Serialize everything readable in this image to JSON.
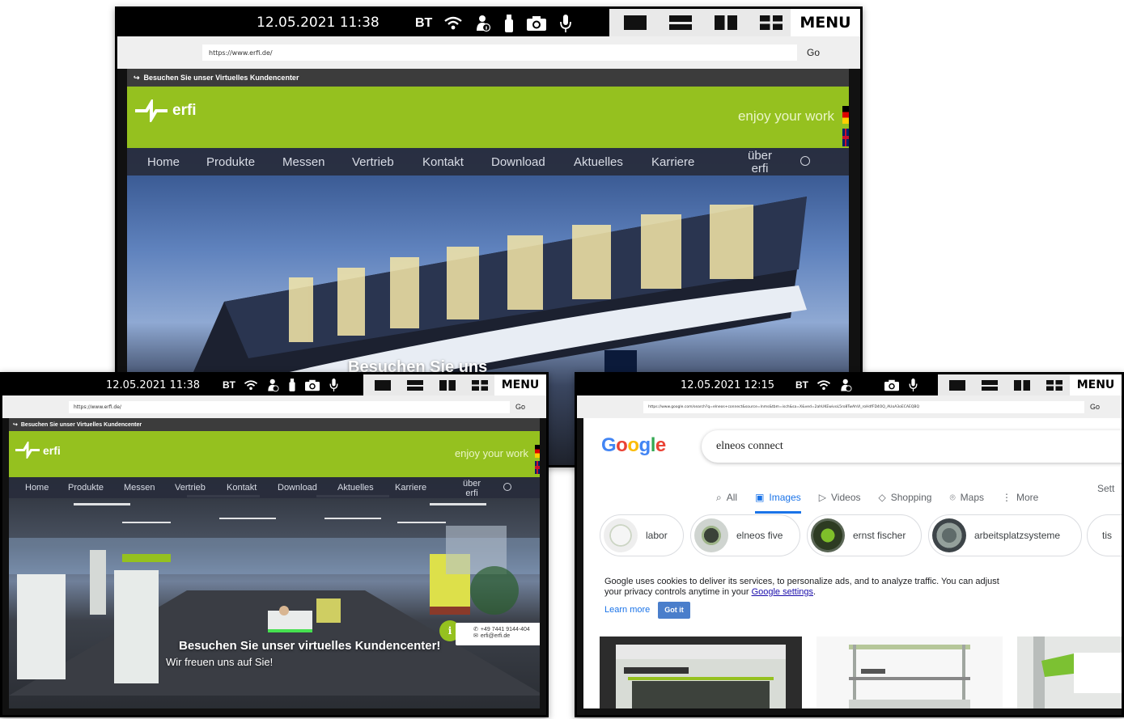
{
  "screen_top": {
    "status": {
      "datetime": "12.05.2021 11:38",
      "bt": "BT",
      "icons": [
        "wifi-icon",
        "person-info-icon",
        "usb-icon",
        "camera-icon",
        "microphone-icon"
      ],
      "layouts": [
        "layout-single-icon",
        "layout-split-horizontal-icon",
        "layout-split-vertical-icon",
        "layout-quad-icon"
      ],
      "menu": "MENU"
    },
    "browser": {
      "url": "https://www.erfi.de/",
      "go": "Go"
    },
    "site": {
      "topstrip": "Besuchen Sie unser Virtuelles Kundencenter",
      "logo": "erfi",
      "tagline": "enjoy your work",
      "nav": [
        "Home",
        "Produkte",
        "Messen",
        "Vertrieb",
        "Kontakt",
        "Download",
        "Aktuelles",
        "Karriere",
        "über erfi"
      ],
      "hero_title": "Besuchen Sie uns"
    }
  },
  "screen_left": {
    "status": {
      "datetime": "12.05.2021 11:38",
      "bt": "BT",
      "menu": "MENU"
    },
    "browser": {
      "url": "https://www.erfi.de/",
      "go": "Go"
    },
    "site": {
      "topstrip": "Besuchen Sie unser Virtuelles Kundencenter",
      "logo": "erfi",
      "tagline": "enjoy your work",
      "nav": [
        "Home",
        "Produkte",
        "Messen",
        "Vertrieb",
        "Kontakt",
        "Download",
        "Aktuelles",
        "Karriere",
        "über erfi"
      ],
      "hero_title": "Besuchen Sie unser virtuelles Kundencenter!",
      "hero_sub": "Wir freuen uns auf Sie!",
      "phone": "+49 7441 9144-404",
      "email": "erfi@erfi.de"
    }
  },
  "screen_right": {
    "status": {
      "datetime": "12.05.2021 12:15",
      "bt": "BT",
      "menu": "MENU"
    },
    "browser": {
      "url": "https://www.google.com/search?q=elneos+connect&source=lnms&tbm=isch&sa=X&ved=2ahUKEwivoL5ro8TwAhVl_roHdfFD4OQ_AUoA3oECAEQBQ",
      "go": "Go"
    },
    "google": {
      "logo": "Google",
      "query": "elneos connect",
      "tabs": [
        {
          "icon": "search-icon",
          "label": "All"
        },
        {
          "icon": "image-icon",
          "label": "Images"
        },
        {
          "icon": "video-icon",
          "label": "Videos"
        },
        {
          "icon": "tag-icon",
          "label": "Shopping"
        },
        {
          "icon": "map-pin-icon",
          "label": "Maps"
        },
        {
          "icon": "more-vertical-icon",
          "label": "More"
        }
      ],
      "settings": "Sett",
      "chips": [
        "labor",
        "elneos five",
        "ernst fischer",
        "arbeitsplatzsysteme",
        "tis"
      ],
      "cookie_text": "Google uses cookies to deliver its services, to personalize ads, and to analyze traffic. You can adjust your privacy controls anytime in your",
      "cookie_link": "Google settings",
      "cookie_period": ".",
      "learn_more": "Learn more",
      "got_it": "Got it"
    }
  },
  "colors": {
    "erfi_green": "#95c11f",
    "nav_bg": "#2d3244",
    "google_blue": "#1a73e8"
  }
}
